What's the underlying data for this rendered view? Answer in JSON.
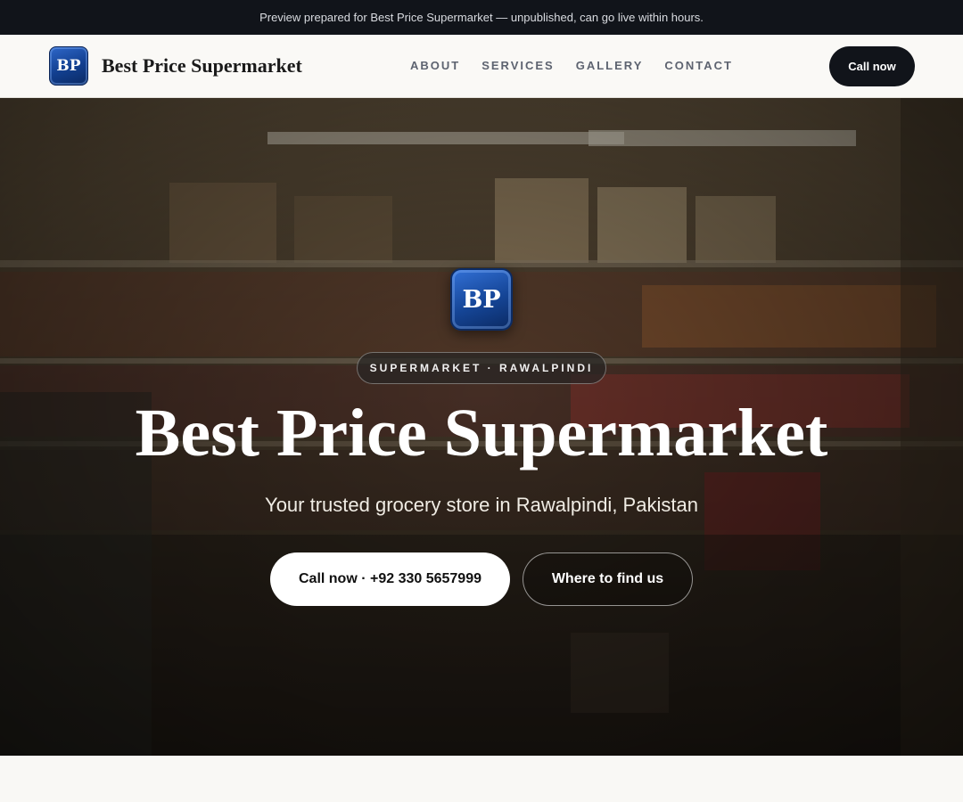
{
  "banner": {
    "text": "Preview prepared for Best Price Supermarket — unpublished, can go live within hours."
  },
  "header": {
    "logo_text": "BP",
    "brand_name": "Best Price Supermarket",
    "nav": [
      {
        "label": "ABOUT"
      },
      {
        "label": "SERVICES"
      },
      {
        "label": "GALLERY"
      },
      {
        "label": "CONTACT"
      }
    ],
    "call_label": "Call now"
  },
  "hero": {
    "logo_text": "BP",
    "eyebrow": "SUPERMARKET · RAWALPINDI",
    "title": "Best Price Supermarket",
    "subtitle": "Your trusted grocery store in Rawalpindi, Pakistan",
    "primary_button": "Call now · +92 330 5657999",
    "secondary_button": "Where to find us"
  },
  "colors": {
    "banner_bg": "#11141a",
    "accent_dark": "#11141a",
    "logo_blue": "#154596",
    "page_bg": "#f8f7f4"
  }
}
